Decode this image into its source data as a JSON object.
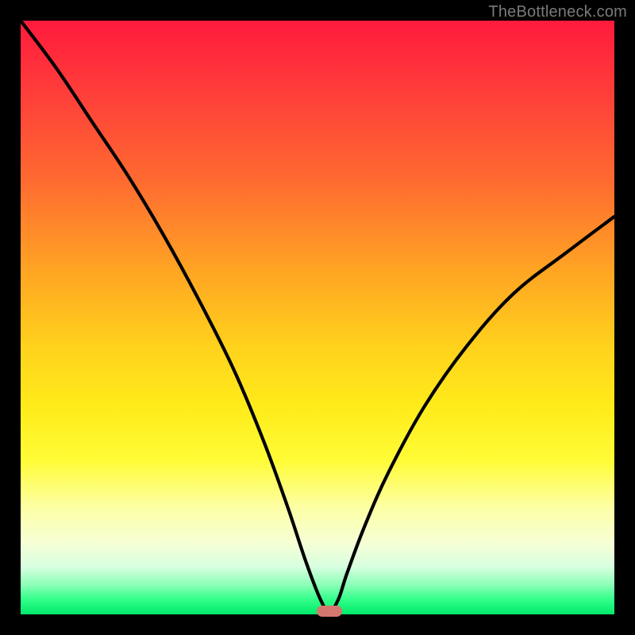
{
  "watermark": "TheBottleneck.com",
  "chart_data": {
    "type": "line",
    "title": "",
    "xlabel": "",
    "ylabel": "",
    "xlim": [
      0,
      100
    ],
    "ylim": [
      0,
      100
    ],
    "series": [
      {
        "name": "curve",
        "x": [
          0,
          6,
          12,
          18,
          24,
          30,
          36,
          41,
          45,
          48,
          50.5,
          52,
          53.5,
          55,
          58,
          62,
          68,
          75,
          83,
          92,
          100
        ],
        "values": [
          100,
          92,
          83,
          74,
          64,
          53,
          41,
          29,
          18,
          9,
          2.5,
          0.5,
          2.5,
          7,
          15,
          24,
          35,
          45,
          54,
          61,
          67
        ]
      }
    ],
    "marker": {
      "x": 52,
      "y": 0.5
    },
    "background_gradient": {
      "top": "#ff1a3c",
      "mid": "#ffeb1a",
      "bottom": "#00e96b"
    },
    "colors": {
      "curve": "#000000",
      "marker": "#d4776f",
      "frame": "#000000",
      "watermark": "#7a7a7a"
    }
  }
}
